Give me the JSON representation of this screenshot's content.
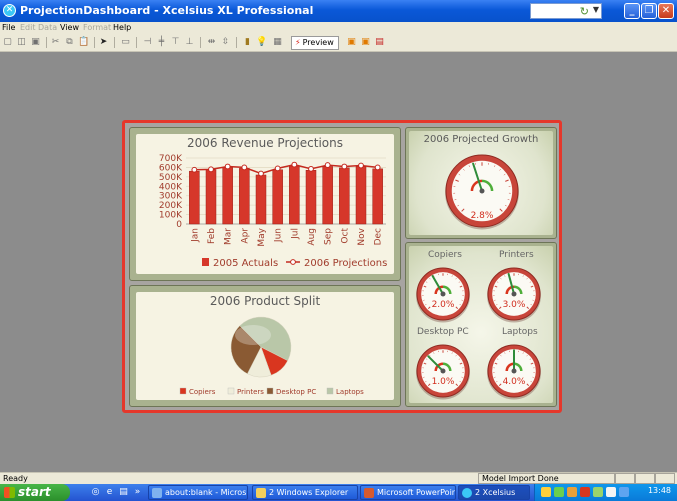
{
  "window": {
    "title": "ProjectionDashboard - Xcelsius XL Professional",
    "minimize_glyph": "_",
    "maximize_glyph": "❐",
    "close_glyph": "✕"
  },
  "menu": [
    "File",
    "Edit",
    "Data",
    "View",
    "Format",
    "Help"
  ],
  "toolbar": {
    "preview_label": "Preview"
  },
  "dashboard": {
    "revenue": {
      "title": "2006 Revenue Projections",
      "legend_actuals": "2005 Actuals",
      "legend_projections": "2006 Projections"
    },
    "growth": {
      "title": "2006 Projected Growth",
      "value_text": "2.8%",
      "value": 2.8
    },
    "split": {
      "title": "2006 Product Split",
      "legend": [
        "Copiers",
        "Printers",
        "Desktop PC",
        "Laptops"
      ]
    },
    "gauges": [
      {
        "label": "Copiers",
        "value_text": "2.0%",
        "value": 2.0
      },
      {
        "label": "Printers",
        "value_text": "3.0%",
        "value": 3.0
      },
      {
        "label": "Desktop PC",
        "value_text": "1.0%",
        "value": 1.0
      },
      {
        "label": "Laptops",
        "value_text": "4.0%",
        "value": 4.0
      }
    ],
    "colors": {
      "frame_border": "#e5372b",
      "bar": "#d6372a",
      "line": "#c42a1f",
      "copiers": "#d9361f",
      "printers": "#efedda",
      "desktop": "#8a5a33",
      "laptops": "#b9c7a8"
    }
  },
  "chart_data": [
    {
      "type": "bar",
      "title": "2006 Revenue Projections",
      "categories": [
        "Jan",
        "Feb",
        "Mar",
        "Apr",
        "May",
        "Jun",
        "Jul",
        "Aug",
        "Sep",
        "Oct",
        "Nov",
        "Dec"
      ],
      "yticks": [
        "700K",
        "600K",
        "500K",
        "400K",
        "300K",
        "200K",
        "100K",
        "0"
      ],
      "ylim": [
        0,
        700000
      ],
      "series": [
        {
          "name": "2005 Actuals",
          "type": "bar",
          "values": [
            560000,
            575000,
            600000,
            590000,
            520000,
            575000,
            615000,
            570000,
            610000,
            595000,
            610000,
            585000
          ]
        },
        {
          "name": "2006 Projections",
          "type": "line",
          "values": [
            575000,
            580000,
            610000,
            600000,
            535000,
            590000,
            630000,
            585000,
            625000,
            610000,
            620000,
            600000
          ]
        }
      ],
      "legend": "bottom"
    },
    {
      "type": "pie",
      "title": "2006 Product Split",
      "labels": [
        "Copiers",
        "Printers",
        "Desktop PC",
        "Laptops"
      ],
      "values": [
        12,
        13,
        30,
        45
      ],
      "legend": "bottom"
    }
  ],
  "status": {
    "left": "Ready",
    "model": "Model Import Done"
  },
  "taskbar": {
    "start": "start",
    "tasks": [
      "about:blank - Micros...",
      "2 Windows Explorer",
      "Microsoft PowerPoint...",
      "2 Xcelsius"
    ],
    "clock": "13:48"
  }
}
